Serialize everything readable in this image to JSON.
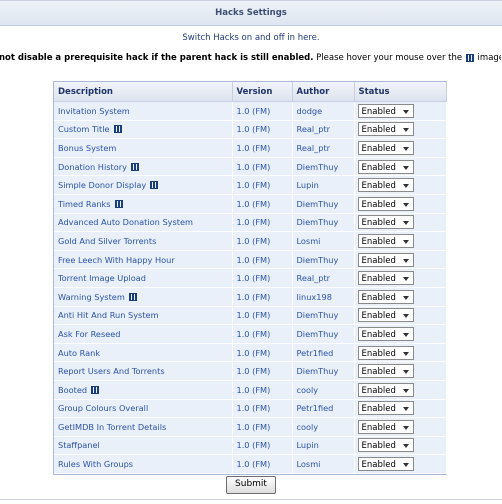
{
  "panel": {
    "title": "Hacks Settings",
    "intro": "Switch Hacks on and off in here.",
    "warning_bold": "not disable a prerequisite hack if the parent hack is still enabled.",
    "warning_rest": " Please hover your mouse over the",
    "warning_tail": "images below to find out w"
  },
  "table": {
    "headers": {
      "description": "Description",
      "version": "Version",
      "author": "Author",
      "status": "Status"
    },
    "rows": [
      {
        "description": "Invitation System",
        "icon": false,
        "version": "1.0 (FM)",
        "author": "dodge",
        "status": "Enabled"
      },
      {
        "description": "Custom Title",
        "icon": true,
        "version": "1.0 (FM)",
        "author": "Real_ptr",
        "status": "Enabled"
      },
      {
        "description": "Bonus System",
        "icon": false,
        "version": "1.0 (FM)",
        "author": "Real_ptr",
        "status": "Enabled"
      },
      {
        "description": "Donation History",
        "icon": true,
        "version": "1.0 (FM)",
        "author": "DiemThuy",
        "status": "Enabled"
      },
      {
        "description": "Simple Donor Display",
        "icon": true,
        "version": "1.0 (FM)",
        "author": "Lupin",
        "status": "Enabled"
      },
      {
        "description": "Timed Ranks",
        "icon": true,
        "version": "1.0 (FM)",
        "author": "DiemThuy",
        "status": "Enabled"
      },
      {
        "description": "Advanced Auto Donation System",
        "icon": false,
        "version": "1.0 (FM)",
        "author": "DiemThuy",
        "status": "Enabled"
      },
      {
        "description": "Gold And Silver Torrents",
        "icon": false,
        "version": "1.0 (FM)",
        "author": "Losmi",
        "status": "Enabled"
      },
      {
        "description": "Free Leech With Happy Hour",
        "icon": false,
        "version": "1.0 (FM)",
        "author": "DiemThuy",
        "status": "Enabled"
      },
      {
        "description": "Torrent Image Upload",
        "icon": false,
        "version": "1.0 (FM)",
        "author": "Real_ptr",
        "status": "Enabled"
      },
      {
        "description": "Warning System",
        "icon": true,
        "version": "1.0 (FM)",
        "author": "linux198",
        "status": "Enabled"
      },
      {
        "description": "Anti Hit And Run System",
        "icon": false,
        "version": "1.0 (FM)",
        "author": "DiemThuy",
        "status": "Enabled"
      },
      {
        "description": "Ask For Reseed",
        "icon": false,
        "version": "1.0 (FM)",
        "author": "DiemThuy",
        "status": "Enabled"
      },
      {
        "description": "Auto Rank",
        "icon": false,
        "version": "1.0 (FM)",
        "author": "Petr1fied",
        "status": "Enabled"
      },
      {
        "description": "Report Users And Torrents",
        "icon": false,
        "version": "1.0 (FM)",
        "author": "DiemThuy",
        "status": "Enabled"
      },
      {
        "description": "Booted",
        "icon": true,
        "version": "1.0 (FM)",
        "author": "cooly",
        "status": "Enabled"
      },
      {
        "description": "Group Colours Overall",
        "icon": false,
        "version": "1.0 (FM)",
        "author": "Petr1fied",
        "status": "Enabled"
      },
      {
        "description": "GetIMDB In Torrent Details",
        "icon": false,
        "version": "1.0 (FM)",
        "author": "cooly",
        "status": "Enabled"
      },
      {
        "description": "Staffpanel",
        "icon": false,
        "version": "1.0 (FM)",
        "author": "Lupin",
        "status": "Enabled"
      },
      {
        "description": "Rules With Groups",
        "icon": false,
        "version": "1.0 (FM)",
        "author": "Losmi",
        "status": "Enabled"
      }
    ]
  },
  "form": {
    "submit_label": "Submit"
  },
  "icons": {
    "info_icon": "pause-bars-icon",
    "select_caret": "chevron-down-icon"
  }
}
